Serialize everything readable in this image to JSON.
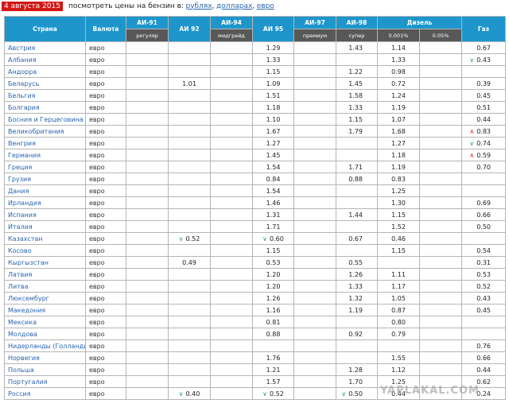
{
  "header": {
    "date": "4 августа 2015",
    "prompt": "посмотреть цены на бензин в:",
    "links": [
      "рублях",
      "долларах",
      "евро"
    ],
    "separator": ","
  },
  "table": {
    "col_country": "Страна",
    "col_currency": "Валюта",
    "col_ai91": "АИ-91",
    "col_ai92": "АИ 92",
    "col_ai94": "АИ-94",
    "col_ai95": "АИ 95",
    "col_ai97": "АИ-97",
    "col_ai98": "АИ-98",
    "col_diesel": "Дизель",
    "col_gas": "Газ",
    "sub_ai91": "регуляр",
    "sub_ai94": "мидгрейд",
    "sub_ai97": "премиум",
    "sub_ai98": "супер",
    "sub_diesel1": "0.001%",
    "sub_diesel2": "0.05%",
    "rows": [
      {
        "country": "Австрия",
        "currency": "евро",
        "ai95": "1.29",
        "ai98": "1.43",
        "d1": "1.14",
        "gas": "0.67"
      },
      {
        "country": "Албания",
        "currency": "евро",
        "ai95": "1.33",
        "d1": "1.33",
        "gas": "0.43",
        "gas_trend": "down"
      },
      {
        "country": "Андорра",
        "currency": "евро",
        "ai95": "1.15",
        "ai98": "1.22",
        "d1": "0.98"
      },
      {
        "country": "Беларусь",
        "currency": "евро",
        "ai92": "1.01",
        "ai95": "1.09",
        "ai98": "1.45",
        "d1": "0.72",
        "gas": "0.39"
      },
      {
        "country": "Бельгия",
        "currency": "евро",
        "ai95": "1.51",
        "ai98": "1.58",
        "d1": "1.24",
        "gas": "0.45"
      },
      {
        "country": "Болгария",
        "currency": "евро",
        "ai95": "1.18",
        "ai98": "1.33",
        "d1": "1.19",
        "gas": "0.51"
      },
      {
        "country": "Босния и Герцеговина",
        "currency": "евро",
        "ai95": "1.10",
        "ai98": "1.15",
        "d1": "1.07",
        "gas": "0.44"
      },
      {
        "country": "Великобритания",
        "currency": "евро",
        "ai95": "1.67",
        "ai98": "1.79",
        "d1": "1.68",
        "gas": "0.83",
        "gas_trend": "up"
      },
      {
        "country": "Венгрия",
        "currency": "евро",
        "ai95": "1.27",
        "d1": "1.27",
        "gas": "0.74",
        "gas_trend": "down"
      },
      {
        "country": "Германия",
        "currency": "евро",
        "ai95": "1.45",
        "d1": "1.18",
        "gas": "0.59",
        "gas_trend": "up"
      },
      {
        "country": "Греция",
        "currency": "евро",
        "ai95": "1.54",
        "ai98": "1.71",
        "d1": "1.19",
        "gas": "0.70"
      },
      {
        "country": "Грузия",
        "currency": "евро",
        "ai95": "0.84",
        "ai98": "0.88",
        "d1": "0.83"
      },
      {
        "country": "Дания",
        "currency": "евро",
        "ai95": "1.54",
        "d1": "1.25"
      },
      {
        "country": "Ирландия",
        "currency": "евро",
        "ai95": "1.46",
        "d1": "1.30",
        "gas": "0.69"
      },
      {
        "country": "Испания",
        "currency": "евро",
        "ai95": "1.31",
        "ai98": "1.44",
        "d1": "1.15",
        "gas": "0.66"
      },
      {
        "country": "Италия",
        "currency": "евро",
        "ai95": "1.71",
        "d1": "1.52",
        "gas": "0.50"
      },
      {
        "country": "Казахстан",
        "currency": "евро",
        "ai92": "0.52",
        "ai92_trend": "down",
        "ai95": "0.60",
        "ai95_trend": "down",
        "ai98": "0.67",
        "d1": "0.46"
      },
      {
        "country": "Косово",
        "currency": "евро",
        "ai95": "1.15",
        "d1": "1.15",
        "gas": "0.54"
      },
      {
        "country": "Кыргызстан",
        "currency": "евро",
        "ai92": "0.49",
        "ai95": "0.53",
        "ai98": "0.55",
        "gas": "0.31"
      },
      {
        "country": "Латвия",
        "currency": "евро",
        "ai95": "1.20",
        "ai98": "1.26",
        "d1": "1.11",
        "gas": "0.53"
      },
      {
        "country": "Литва",
        "currency": "евро",
        "ai95": "1.20",
        "ai98": "1.33",
        "d1": "1.17",
        "gas": "0.52"
      },
      {
        "country": "Люксембург",
        "currency": "евро",
        "ai95": "1.26",
        "ai98": "1.32",
        "d1": "1.05",
        "gas": "0.43"
      },
      {
        "country": "Македония",
        "currency": "евро",
        "ai95": "1.16",
        "ai98": "1.19",
        "d1": "0.87",
        "gas": "0.45"
      },
      {
        "country": "Мексика",
        "currency": "евро",
        "ai95": "0.81",
        "d1": "0.80"
      },
      {
        "country": "Молдова",
        "currency": "евро",
        "ai95": "0.88",
        "ai98": "0.92",
        "d1": "0.79"
      },
      {
        "country": "Нидерланды (Голландия)",
        "currency": "евро",
        "gas": "0.76"
      },
      {
        "country": "Норвегия",
        "currency": "евро",
        "ai95": "1.76",
        "d1": "1.55",
        "gas": "0.66"
      },
      {
        "country": "Польша",
        "currency": "евро",
        "ai95": "1.21",
        "ai98": "1.28",
        "d1": "1.12",
        "gas": "0.44"
      },
      {
        "country": "Португалия",
        "currency": "евро",
        "ai95": "1.57",
        "ai98": "1.70",
        "d1": "1.25",
        "gas": "0.62"
      },
      {
        "country": "Россия",
        "currency": "евро",
        "ai92": "0.40",
        "ai92_trend": "down",
        "ai95": "0.52",
        "ai95_trend": "down",
        "ai98": "0.50",
        "ai98_trend": "down",
        "d1": "0.44",
        "gas": "0.24"
      }
    ]
  },
  "watermark": "YAPLAKAL.COM",
  "colors": {
    "header_bg": "#1e96cc",
    "subheader_bg": "#585858",
    "date_bg": "#d41616",
    "link": "#2a64b0",
    "trend_up": "#d41616",
    "trend_down": "#22a06b"
  },
  "icons": {
    "trend_up": "caret-up-icon",
    "trend_down": "caret-down-icon"
  }
}
